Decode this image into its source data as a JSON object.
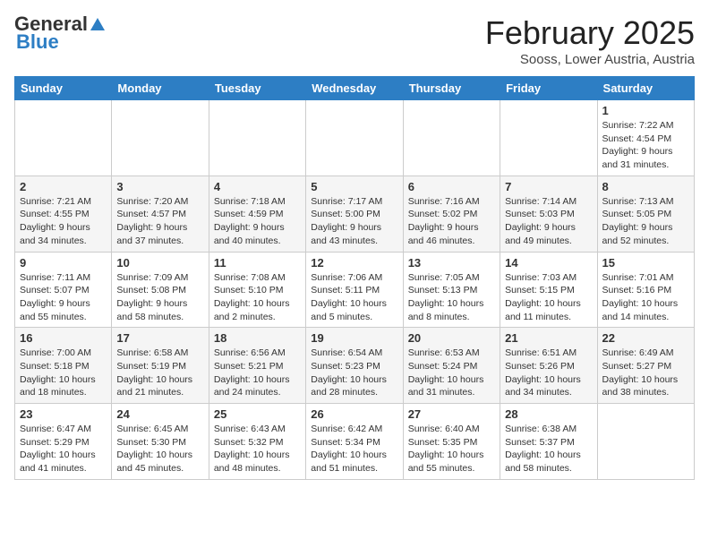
{
  "header": {
    "logo_general": "General",
    "logo_blue": "Blue",
    "month_year": "February 2025",
    "location": "Sooss, Lower Austria, Austria"
  },
  "days_of_week": [
    "Sunday",
    "Monday",
    "Tuesday",
    "Wednesday",
    "Thursday",
    "Friday",
    "Saturday"
  ],
  "weeks": [
    [
      {
        "day": "",
        "info": ""
      },
      {
        "day": "",
        "info": ""
      },
      {
        "day": "",
        "info": ""
      },
      {
        "day": "",
        "info": ""
      },
      {
        "day": "",
        "info": ""
      },
      {
        "day": "",
        "info": ""
      },
      {
        "day": "1",
        "info": "Sunrise: 7:22 AM\nSunset: 4:54 PM\nDaylight: 9 hours and 31 minutes."
      }
    ],
    [
      {
        "day": "2",
        "info": "Sunrise: 7:21 AM\nSunset: 4:55 PM\nDaylight: 9 hours and 34 minutes."
      },
      {
        "day": "3",
        "info": "Sunrise: 7:20 AM\nSunset: 4:57 PM\nDaylight: 9 hours and 37 minutes."
      },
      {
        "day": "4",
        "info": "Sunrise: 7:18 AM\nSunset: 4:59 PM\nDaylight: 9 hours and 40 minutes."
      },
      {
        "day": "5",
        "info": "Sunrise: 7:17 AM\nSunset: 5:00 PM\nDaylight: 9 hours and 43 minutes."
      },
      {
        "day": "6",
        "info": "Sunrise: 7:16 AM\nSunset: 5:02 PM\nDaylight: 9 hours and 46 minutes."
      },
      {
        "day": "7",
        "info": "Sunrise: 7:14 AM\nSunset: 5:03 PM\nDaylight: 9 hours and 49 minutes."
      },
      {
        "day": "8",
        "info": "Sunrise: 7:13 AM\nSunset: 5:05 PM\nDaylight: 9 hours and 52 minutes."
      }
    ],
    [
      {
        "day": "9",
        "info": "Sunrise: 7:11 AM\nSunset: 5:07 PM\nDaylight: 9 hours and 55 minutes."
      },
      {
        "day": "10",
        "info": "Sunrise: 7:09 AM\nSunset: 5:08 PM\nDaylight: 9 hours and 58 minutes."
      },
      {
        "day": "11",
        "info": "Sunrise: 7:08 AM\nSunset: 5:10 PM\nDaylight: 10 hours and 2 minutes."
      },
      {
        "day": "12",
        "info": "Sunrise: 7:06 AM\nSunset: 5:11 PM\nDaylight: 10 hours and 5 minutes."
      },
      {
        "day": "13",
        "info": "Sunrise: 7:05 AM\nSunset: 5:13 PM\nDaylight: 10 hours and 8 minutes."
      },
      {
        "day": "14",
        "info": "Sunrise: 7:03 AM\nSunset: 5:15 PM\nDaylight: 10 hours and 11 minutes."
      },
      {
        "day": "15",
        "info": "Sunrise: 7:01 AM\nSunset: 5:16 PM\nDaylight: 10 hours and 14 minutes."
      }
    ],
    [
      {
        "day": "16",
        "info": "Sunrise: 7:00 AM\nSunset: 5:18 PM\nDaylight: 10 hours and 18 minutes."
      },
      {
        "day": "17",
        "info": "Sunrise: 6:58 AM\nSunset: 5:19 PM\nDaylight: 10 hours and 21 minutes."
      },
      {
        "day": "18",
        "info": "Sunrise: 6:56 AM\nSunset: 5:21 PM\nDaylight: 10 hours and 24 minutes."
      },
      {
        "day": "19",
        "info": "Sunrise: 6:54 AM\nSunset: 5:23 PM\nDaylight: 10 hours and 28 minutes."
      },
      {
        "day": "20",
        "info": "Sunrise: 6:53 AM\nSunset: 5:24 PM\nDaylight: 10 hours and 31 minutes."
      },
      {
        "day": "21",
        "info": "Sunrise: 6:51 AM\nSunset: 5:26 PM\nDaylight: 10 hours and 34 minutes."
      },
      {
        "day": "22",
        "info": "Sunrise: 6:49 AM\nSunset: 5:27 PM\nDaylight: 10 hours and 38 minutes."
      }
    ],
    [
      {
        "day": "23",
        "info": "Sunrise: 6:47 AM\nSunset: 5:29 PM\nDaylight: 10 hours and 41 minutes."
      },
      {
        "day": "24",
        "info": "Sunrise: 6:45 AM\nSunset: 5:30 PM\nDaylight: 10 hours and 45 minutes."
      },
      {
        "day": "25",
        "info": "Sunrise: 6:43 AM\nSunset: 5:32 PM\nDaylight: 10 hours and 48 minutes."
      },
      {
        "day": "26",
        "info": "Sunrise: 6:42 AM\nSunset: 5:34 PM\nDaylight: 10 hours and 51 minutes."
      },
      {
        "day": "27",
        "info": "Sunrise: 6:40 AM\nSunset: 5:35 PM\nDaylight: 10 hours and 55 minutes."
      },
      {
        "day": "28",
        "info": "Sunrise: 6:38 AM\nSunset: 5:37 PM\nDaylight: 10 hours and 58 minutes."
      },
      {
        "day": "",
        "info": ""
      }
    ]
  ]
}
